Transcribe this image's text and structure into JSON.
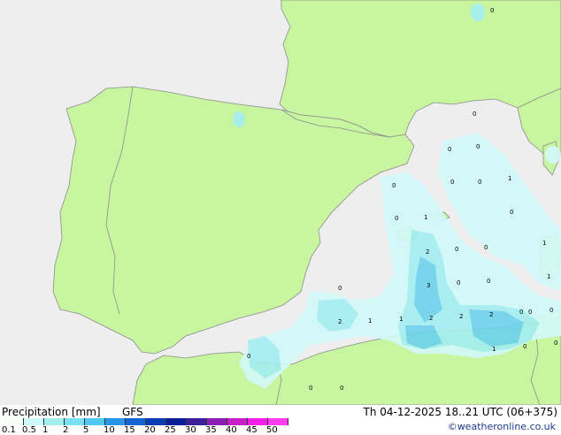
{
  "legend": {
    "title": "Precipitation [mm]",
    "model": "GFS",
    "datetime": "Th 04-12-2025 18..21 UTC (06+375)",
    "credit": "©weatheronline.co.uk",
    "scale_ticks": [
      "0.1",
      "0.5",
      "1",
      "2",
      "5",
      "10",
      "15",
      "20",
      "25",
      "30",
      "35",
      "40",
      "45",
      "50"
    ],
    "scale_colors": [
      "#f5fff5",
      "#cdfafa",
      "#a4f0f0",
      "#78e0f0",
      "#50c8f0",
      "#2896e6",
      "#1464d2",
      "#0a3cb4",
      "#0a1e96",
      "#3c1e96",
      "#8c1eb4",
      "#c81ec8",
      "#f01ee6",
      "#ff3cf0"
    ]
  },
  "map": {
    "land_color": "#c8f5a0",
    "sea_color": "#eeeeee",
    "border_color": "#8c8c8c",
    "precip_colors": {
      "light": "#d2fafa",
      "medium": "#a4eef2",
      "heavy": "#6ed2ec"
    },
    "labels": [
      {
        "id": "l1",
        "text": "0"
      },
      {
        "id": "l2",
        "text": "0"
      },
      {
        "id": "l3",
        "text": "0"
      },
      {
        "id": "l4",
        "text": "0"
      },
      {
        "id": "l5",
        "text": "0"
      },
      {
        "id": "l6",
        "text": "0"
      },
      {
        "id": "l7",
        "text": "0"
      },
      {
        "id": "l8",
        "text": "1"
      },
      {
        "id": "l9",
        "text": "0"
      },
      {
        "id": "l10",
        "text": "2"
      },
      {
        "id": "l11",
        "text": "0"
      },
      {
        "id": "l12",
        "text": "1"
      },
      {
        "id": "l13",
        "text": "3"
      },
      {
        "id": "l14",
        "text": "0"
      },
      {
        "id": "l15",
        "text": "0"
      },
      {
        "id": "l16",
        "text": "0"
      },
      {
        "id": "l17",
        "text": "2"
      },
      {
        "id": "l18",
        "text": "1"
      },
      {
        "id": "l19",
        "text": "1"
      },
      {
        "id": "l20",
        "text": "2"
      },
      {
        "id": "l21",
        "text": "2"
      },
      {
        "id": "l22",
        "text": "2"
      },
      {
        "id": "l23",
        "text": "0"
      },
      {
        "id": "l24",
        "text": "0"
      },
      {
        "id": "l25",
        "text": "1"
      },
      {
        "id": "l26",
        "text": "0"
      },
      {
        "id": "l27",
        "text": "0"
      },
      {
        "id": "l28",
        "text": "0"
      },
      {
        "id": "l29",
        "text": "0"
      },
      {
        "id": "l30",
        "text": "1"
      },
      {
        "id": "l31",
        "text": "1"
      },
      {
        "id": "l32",
        "text": "0"
      },
      {
        "id": "l33",
        "text": "0"
      },
      {
        "id": "l34",
        "text": "0"
      },
      {
        "id": "l35",
        "text": "0"
      }
    ]
  }
}
